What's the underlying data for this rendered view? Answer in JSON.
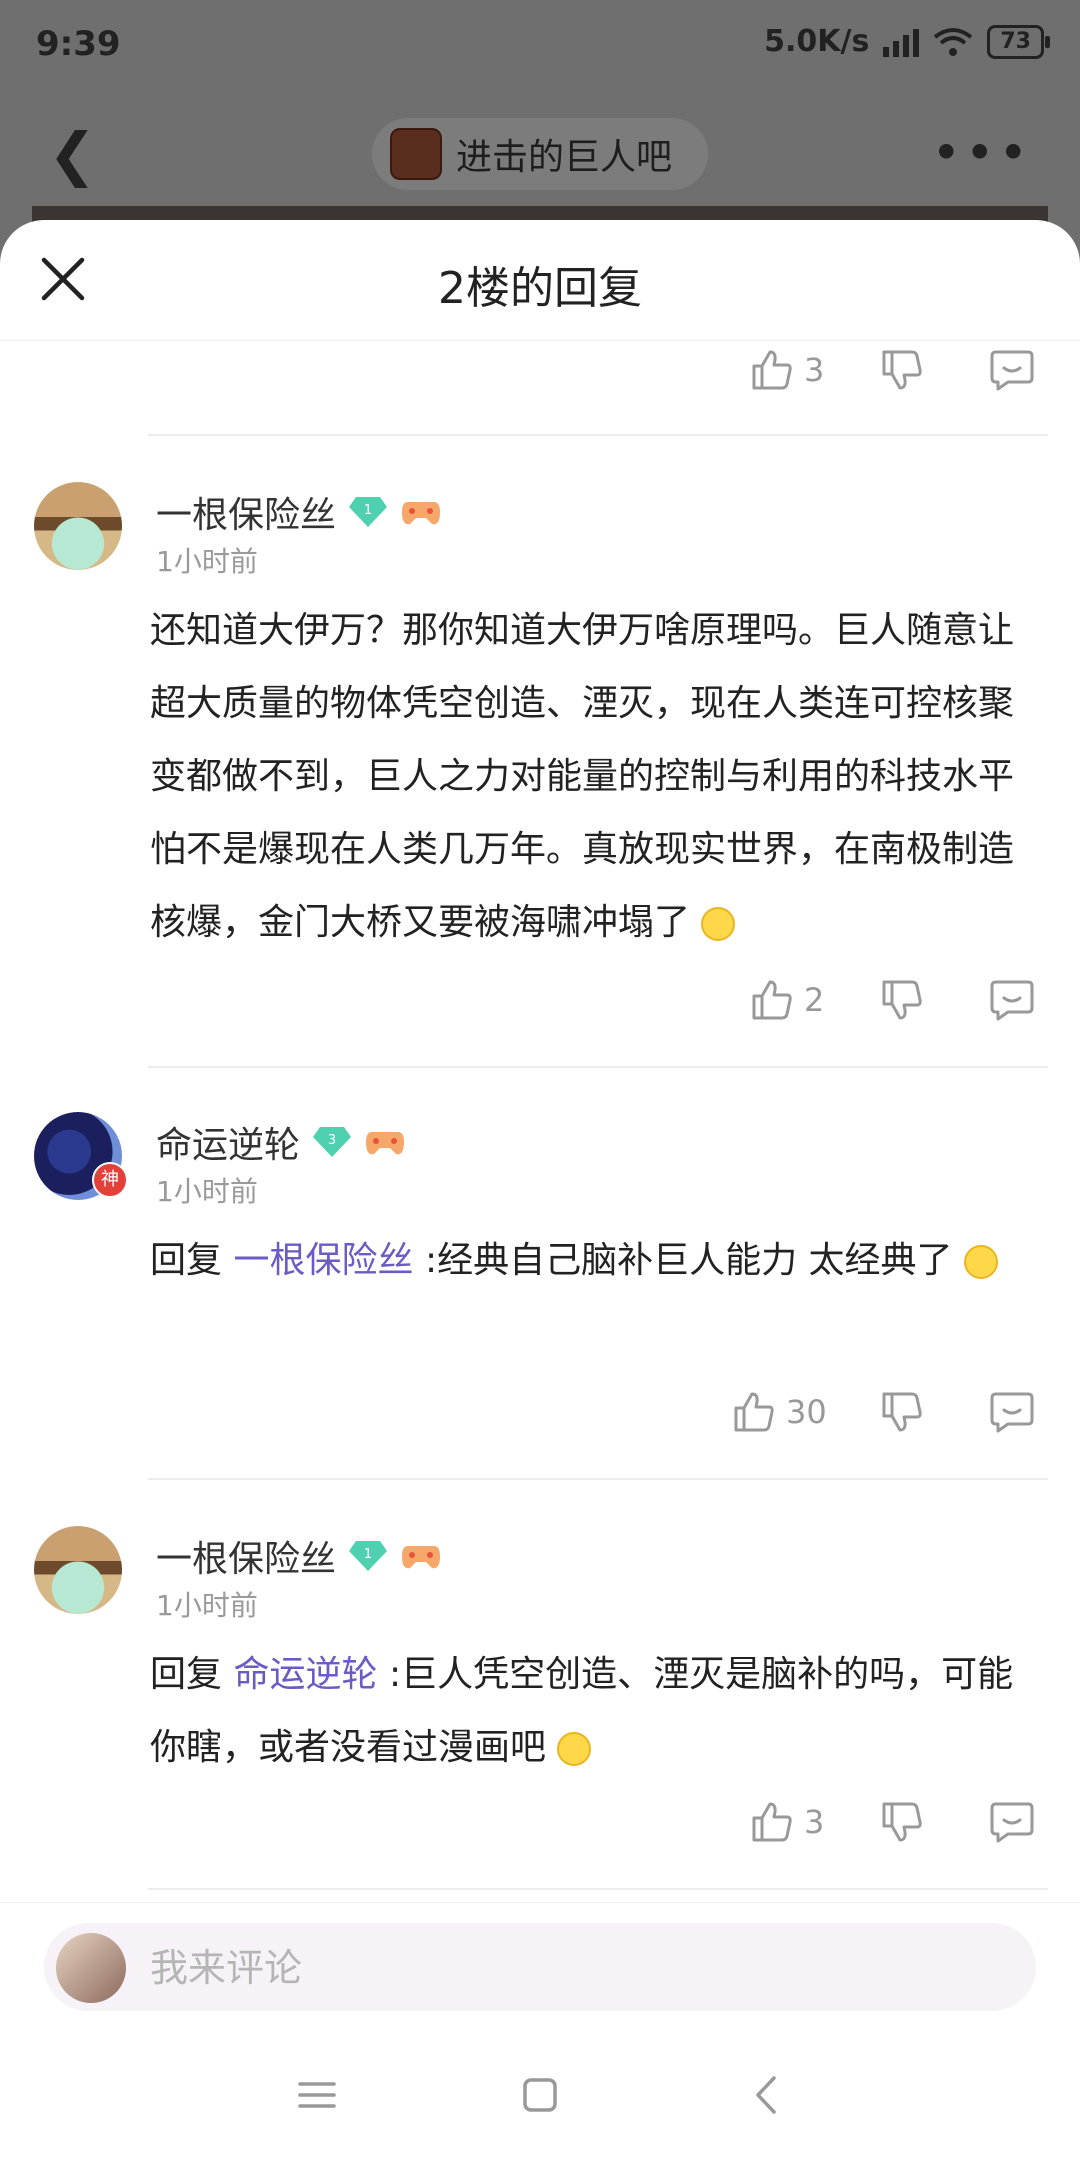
{
  "status_bar": {
    "time": "9:39",
    "speed": "5.0K/s",
    "battery": "73"
  },
  "background_header": {
    "forum_name": "进击的巨人吧"
  },
  "sheet": {
    "title": "2楼的回复"
  },
  "top_actions": {
    "likes": "3"
  },
  "comments": [
    {
      "username": "一根保险丝",
      "level": "1",
      "time": "1小时前",
      "text": "还知道大伊万？那你知道大伊万啥原理吗。巨人随意让超大质量的物体凭空创造、湮灭，现在人类连可控核聚变都做不到，巨人之力对能量的控制与利用的科技水平怕不是爆现在人类几万年。真放现实世界，在南极制造核爆，金门大桥又要被海啸冲塌了",
      "likes": "2"
    },
    {
      "username": "命运逆轮",
      "level": "3",
      "time": "1小时前",
      "reply_prefix": "回复",
      "reply_to": "一根保险丝",
      "text": " :经典自己脑补巨人能力 太经典了",
      "likes": "30",
      "avatar_badge": "神"
    },
    {
      "username": "一根保险丝",
      "level": "1",
      "time": "1小时前",
      "reply_prefix": "回复",
      "reply_to": "命运逆轮",
      "text": " :巨人凭空创造、湮灭是脑补的吗，可能你瞎，或者没看过漫画吧",
      "likes": "3"
    }
  ],
  "input": {
    "placeholder": "我来评论"
  },
  "colors": {
    "mention": "#6b5bc4",
    "gem": "#4fd1b0",
    "text": "#222222",
    "muted": "#9a9a9a"
  }
}
